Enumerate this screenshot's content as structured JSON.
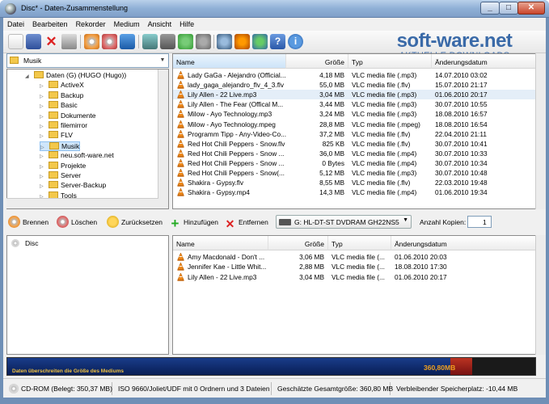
{
  "window": {
    "title": "Disc* - Daten-Zusammenstellung"
  },
  "menu": [
    "Datei",
    "Bearbeiten",
    "Rekorder",
    "Medium",
    "Ansicht",
    "Hilfe"
  ],
  "watermark": {
    "main": "soft-ware.net",
    "sub": "AKTUELLE DOWNLOADS"
  },
  "tree": {
    "path": "Musik",
    "items": [
      {
        "label": "Daten (G) (HUGO (Hugo))",
        "indent": 0,
        "expanded": true
      },
      {
        "label": "ActiveX",
        "indent": 1
      },
      {
        "label": "Backup",
        "indent": 1
      },
      {
        "label": "Basic",
        "indent": 1
      },
      {
        "label": "Dokumente",
        "indent": 1
      },
      {
        "label": "filemirror",
        "indent": 1
      },
      {
        "label": "FLV",
        "indent": 1
      },
      {
        "label": "Musik",
        "indent": 1,
        "selected": true
      },
      {
        "label": "neu.soft-ware.net",
        "indent": 1
      },
      {
        "label": "Projekte",
        "indent": 1
      },
      {
        "label": "Server",
        "indent": 1
      },
      {
        "label": "Server-Backup",
        "indent": 1
      },
      {
        "label": "Tools",
        "indent": 1
      }
    ]
  },
  "files": {
    "headers": [
      "Name",
      "Größe",
      "Typ",
      "Änderungsdatum"
    ],
    "rows": [
      {
        "name": "Lady GaGa - Alejandro (Official...",
        "size": "4,18 MB",
        "type": "VLC media file (.mp3)",
        "date": "14.07.2010 03:02"
      },
      {
        "name": "lady_gaga_alejandro_flv_4_3.flv",
        "size": "55,0 MB",
        "type": "VLC media file (.flv)",
        "date": "15.07.2010 21:17"
      },
      {
        "name": "Lily Allen - 22 Live.mp3",
        "size": "3,04 MB",
        "type": "VLC media file (.mp3)",
        "date": "01.06.2010 20:17",
        "selected": true
      },
      {
        "name": "Lily Allen - The Fear (Offical M...",
        "size": "3,44 MB",
        "type": "VLC media file (.mp3)",
        "date": "30.07.2010 10:55"
      },
      {
        "name": "Milow - Ayo Technology.mp3",
        "size": "3,24 MB",
        "type": "VLC media file (.mp3)",
        "date": "18.08.2010 16:57"
      },
      {
        "name": "Milow - Ayo Technology.mpeg",
        "size": "28,8 MB",
        "type": "VLC media file (.mpeg)",
        "date": "18.08.2010 16:54"
      },
      {
        "name": "Programm Tipp - Any-Video-Co...",
        "size": "37,2 MB",
        "type": "VLC media file (.flv)",
        "date": "22.04.2010 21:11"
      },
      {
        "name": "Red Hot Chili Peppers - Snow.flv",
        "size": "825 KB",
        "type": "VLC media file (.flv)",
        "date": "30.07.2010 10:41"
      },
      {
        "name": "Red Hot Chili Peppers - Snow ...",
        "size": "36,0 MB",
        "type": "VLC media file (.mp4)",
        "date": "30.07.2010 10:33"
      },
      {
        "name": "Red Hot Chili Peppers - Snow ...",
        "size": "0 Bytes",
        "type": "VLC media file (.mp4)",
        "date": "30.07.2010 10:34"
      },
      {
        "name": "Red Hot Chili Peppers - Snow(...",
        "size": "5,12 MB",
        "type": "VLC media file (.mp3)",
        "date": "30.07.2010 10:48"
      },
      {
        "name": "Shakira - Gypsy.flv",
        "size": "8,55 MB",
        "type": "VLC media file (.flv)",
        "date": "22.03.2010 19:48"
      },
      {
        "name": "Shakira - Gypsy.mp4",
        "size": "14,3 MB",
        "type": "VLC media file (.mp4)",
        "date": "01.06.2010 19:34"
      }
    ]
  },
  "actions": {
    "burn": "Brennen",
    "delete": "Löschen",
    "reset": "Zurücksetzen",
    "add": "Hinzufügen",
    "remove": "Entfernen",
    "copies_label": "Anzahl Kopien:",
    "copies_value": "1"
  },
  "drive": {
    "selected": "G: HL-DT-ST DVDRAM GH22NS5"
  },
  "disc": {
    "root": "Disc",
    "headers": [
      "Name",
      "Größe",
      "Typ",
      "Änderungsdatum"
    ],
    "rows": [
      {
        "name": "Amy Macdonald - Don't ...",
        "size": "3,06 MB",
        "type": "VLC media file (...",
        "date": "01.06.2010 20:03"
      },
      {
        "name": "Jennifer Kae - Little Whit...",
        "size": "2,88 MB",
        "type": "VLC media file (...",
        "date": "18.08.2010 17:30"
      },
      {
        "name": "Lily Allen - 22 Live.mp3",
        "size": "3,04 MB",
        "type": "VLC media file (...",
        "date": "01.06.2010 20:17"
      }
    ]
  },
  "capacity": {
    "warning": "Daten überschreiten die Größe des Mediums",
    "size": "360,80MB",
    "fill_fraction": 0.84
  },
  "status": {
    "drive": "CD-ROM (Belegt: 350,37 MB)",
    "fs": "ISO 9660/Joliet/UDF mit 0 Ordnern und 3 Dateien",
    "total": "Geschätzte Gesamtgröße: 360,80 MB",
    "remaining": "Verbleibender Speicherplatz: -10,44 MB"
  },
  "colors": {
    "accent": "#3a6aa8",
    "vlc_orange": "#f08a1c",
    "selection": "#cfe6fb"
  }
}
